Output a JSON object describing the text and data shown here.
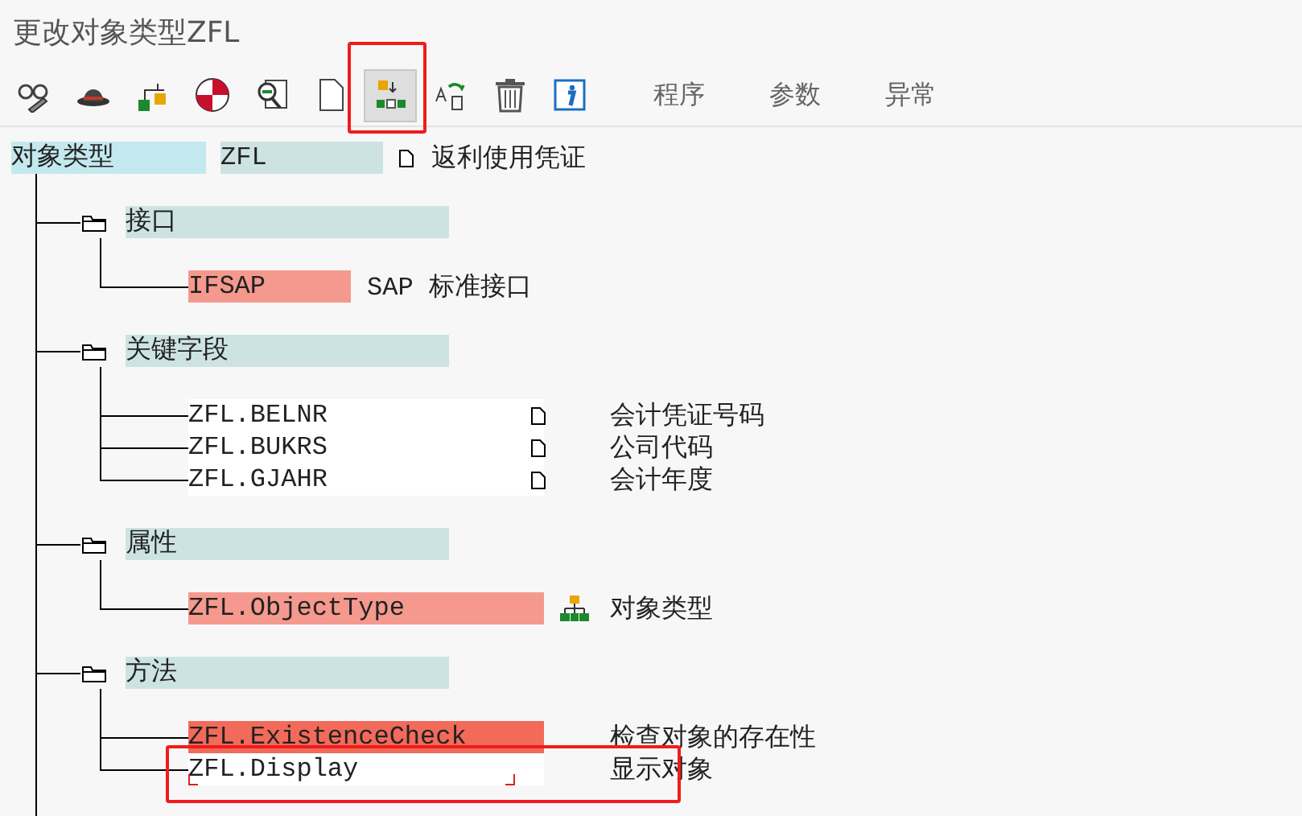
{
  "window": {
    "title": "更改对象类型ZFL"
  },
  "toolbar": {
    "icons": [
      {
        "kind": "glasses",
        "selected": false,
        "highlighted": false
      },
      {
        "kind": "hat",
        "selected": false,
        "highlighted": false
      },
      {
        "kind": "hierarchy",
        "selected": false,
        "highlighted": false
      },
      {
        "kind": "ring",
        "selected": false,
        "highlighted": false
      },
      {
        "kind": "magnifier",
        "selected": false,
        "highlighted": false
      },
      {
        "kind": "page",
        "selected": false,
        "highlighted": false
      },
      {
        "kind": "reorder",
        "selected": true,
        "highlighted": true
      },
      {
        "kind": "rename",
        "selected": false,
        "highlighted": false
      },
      {
        "kind": "trash",
        "selected": false,
        "highlighted": false
      },
      {
        "kind": "info",
        "selected": false,
        "highlighted": false
      }
    ],
    "buttons": [
      "程序",
      "参数",
      "异常"
    ]
  },
  "root": {
    "label": "对象类型",
    "name": "ZFL",
    "description": "返利使用凭证"
  },
  "groups": [
    {
      "label": "接口",
      "children": [
        {
          "kind": "interface",
          "name": "IFSAP",
          "description": "SAP 标准接口",
          "color": "#f5998e",
          "focused": false,
          "highlighted": false
        }
      ]
    },
    {
      "label": "关键字段",
      "children": [
        {
          "kind": "key_field",
          "name": "ZFL.BELNR",
          "description": "会计凭证号码",
          "color": "#ffffff",
          "focused": false,
          "highlighted": false
        },
        {
          "kind": "key_field",
          "name": "ZFL.BUKRS",
          "description": "公司代码",
          "color": "#ffffff",
          "focused": false,
          "highlighted": false
        },
        {
          "kind": "key_field",
          "name": "ZFL.GJAHR",
          "description": "会计年度",
          "color": "#ffffff",
          "focused": false,
          "highlighted": false
        }
      ]
    },
    {
      "label": "属性",
      "children": [
        {
          "kind": "attribute",
          "name": "ZFL.ObjectType",
          "description": "对象类型",
          "color": "#f5998e",
          "focused": false,
          "highlighted": false
        }
      ]
    },
    {
      "label": "方法",
      "children": [
        {
          "kind": "method",
          "name": "ZFL.ExistenceCheck",
          "description": "检查对象的存在性",
          "color": "#f26a5a",
          "focused": false,
          "highlighted": false
        },
        {
          "kind": "method",
          "name": "ZFL.Display",
          "description": "显示对象",
          "color": "#ffffff",
          "focused": true,
          "highlighted": true
        }
      ]
    }
  ]
}
